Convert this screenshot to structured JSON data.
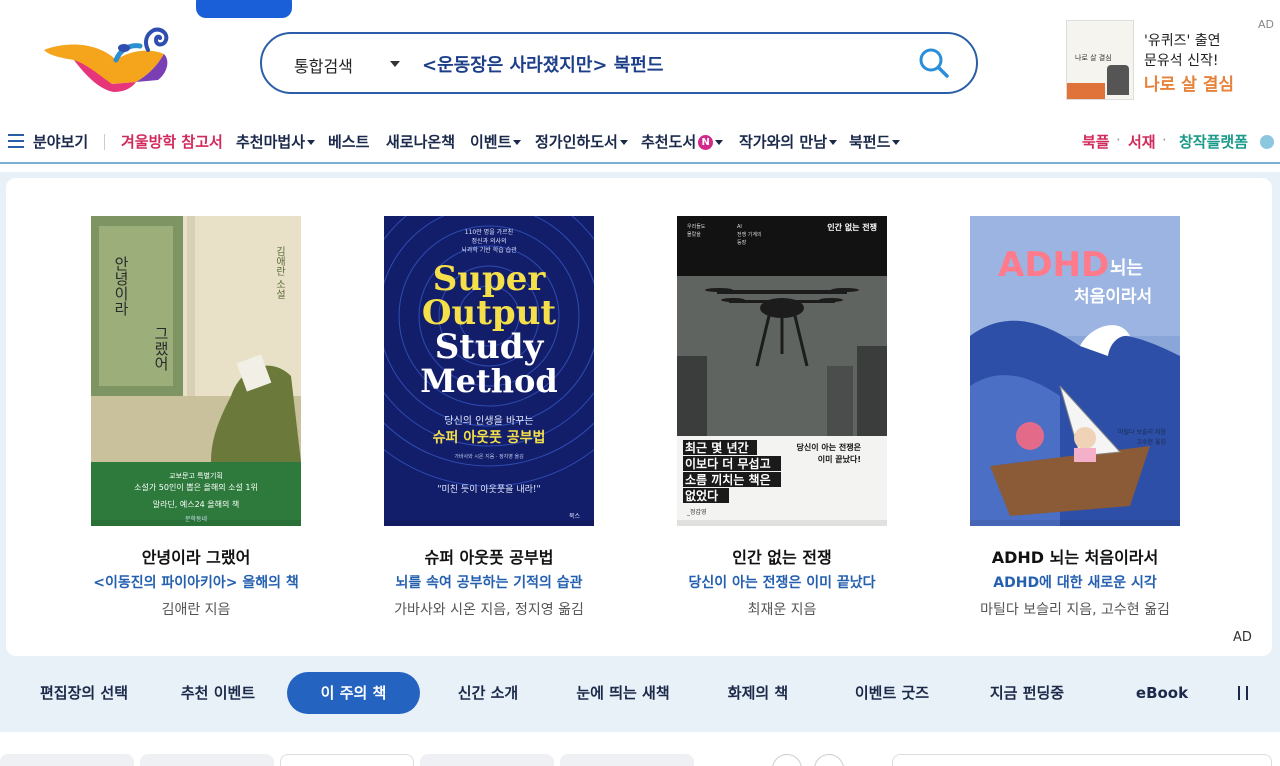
{
  "search": {
    "scope": "통합검색",
    "query": "<운동장은 사라졌지만> 북펀드"
  },
  "top_ad": {
    "book_title": "나로 살 결심",
    "line1": "'유퀴즈' 출연",
    "line2": "문유석 신작!",
    "line3": "나로 살 결심",
    "tag": "AD"
  },
  "nav": {
    "menu_label": "분야보기",
    "items": [
      {
        "label": "겨울방학 참고서"
      },
      {
        "label": "추천마법사"
      },
      {
        "label": "베스트"
      },
      {
        "label": "새로나온책"
      },
      {
        "label": "이벤트"
      },
      {
        "label": "정가인하도서"
      },
      {
        "label": "추천도서",
        "badge": "N"
      },
      {
        "label": "작가와의 만남"
      },
      {
        "label": "북펀드"
      }
    ],
    "right": [
      "북플",
      "서재",
      "창작플랫폼"
    ]
  },
  "books": [
    {
      "title": "안녕이라 그랬어",
      "subtitle": "<이동진의 파이아키아> 올해의 책",
      "author": "김애란 지음",
      "cover_title": "안녕이라 그랬어",
      "cover_author": "김애란 소설",
      "cover_line1": "교보문고 특별기획",
      "cover_line2": "소설가 50인이 뽑은 올해의 소설 1위",
      "cover_line3": "알라딘, 예스24 올해의 책",
      "cover_pub": "문학동네"
    },
    {
      "title": "슈퍼 아웃풋 공부법",
      "subtitle": "뇌를 속여 공부하는 기적의 습관",
      "author": "가바사와 시온 지음, 정지영 옮김",
      "cover_top1": "110만 명을 가르친",
      "cover_top2": "정신과 의사의",
      "cover_top3": "뇌과학 기반 학습 습관",
      "cover_en1": "Super",
      "cover_en2": "Output",
      "cover_en3": "Study",
      "cover_en4": "Method",
      "cover_kr_small": "당신의 인생을 바꾸는",
      "cover_kr_big": "슈퍼 아웃풋 공부법",
      "cover_credit": "가바사와 시온 지음 · 정지영 옮김",
      "cover_quote": "\"미친 듯이 아웃풋을 내라!\"",
      "cover_pub": "북스"
    },
    {
      "title": "인간 없는 전쟁",
      "subtitle": "당신이 아는 전쟁은 이미 끝났다",
      "author": "최재운 지음",
      "cover_title": "인간 없는 전쟁",
      "cover_big1": "최근 몇 년간",
      "cover_big2": "이보다 더 무섭고",
      "cover_big3": "소름 끼치는 책은",
      "cover_big4": "없었다",
      "cover_side1": "당신이 아는 전쟁은",
      "cover_side2": "이미 끝났다!",
      "cover_small_left1": "우리들도",
      "cover_small_left2": "몰랐을",
      "cover_small_mid1": "AI",
      "cover_small_mid2": "전쟁 기계의",
      "cover_small_mid3": "등장",
      "cover_sign": "_정갑영"
    },
    {
      "title": "ADHD 뇌는 처음이라서",
      "subtitle": "ADHD에 대한 새로운 시각",
      "author": "마틸다 보슬리 지음, 고수현 옮김",
      "cover_adhd": "ADHD",
      "cover_line1": "뇌는",
      "cover_line2": "처음이라서",
      "cover_credit1": "마틸다 보슬리 지음",
      "cover_credit2": "고수현 옮김"
    }
  ],
  "panel_ad": "AD",
  "tabs": [
    {
      "label": "편집장의 선택"
    },
    {
      "label": "추천 이벤트"
    },
    {
      "label": "이 주의 책",
      "active": true
    },
    {
      "label": "신간 소개"
    },
    {
      "label": "눈에 띄는 새책"
    },
    {
      "label": "화제의 책"
    },
    {
      "label": "이벤트 굿즈"
    },
    {
      "label": "지금 펀딩중"
    },
    {
      "label": "eBook"
    }
  ],
  "colors": {
    "brand_blue": "#2464c0",
    "nav_red": "#d12a5c",
    "nav_teal": "#1a9a8a",
    "accent_orange": "#e8823a"
  }
}
